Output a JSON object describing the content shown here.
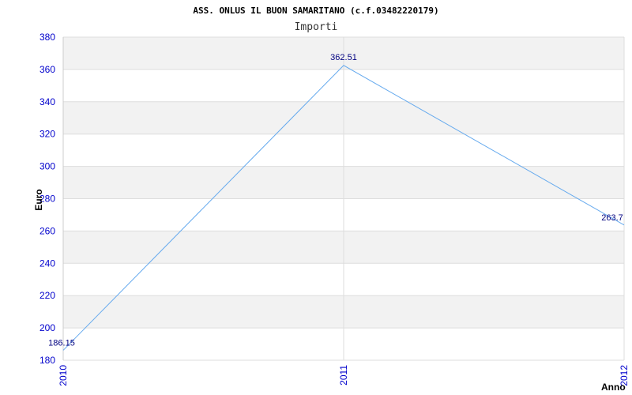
{
  "colors": {
    "band_dark": "#f2f2f2",
    "band_light": "#ffffff",
    "grid": "#dddddd",
    "line": "#66aaee",
    "tick_text": "#0000cc",
    "data_label_text": "#000080"
  },
  "chart_data": {
    "type": "line",
    "title": "ASS. ONLUS IL BUON SAMARITANO (c.f.03482220179)",
    "subtitle": "Importi",
    "xlabel": "Anno",
    "ylabel": "Euro",
    "categories": [
      "2010",
      "2011",
      "2012"
    ],
    "series": [
      {
        "values": [
          186.15,
          362.51,
          263.7
        ]
      }
    ],
    "data_labels": [
      "186.15",
      "362.51",
      "263.7"
    ],
    "ylim": [
      180,
      380
    ],
    "yticks": [
      "180",
      "200",
      "220",
      "240",
      "260",
      "280",
      "300",
      "320",
      "340",
      "360",
      "380"
    ],
    "grid": true,
    "legend": "none"
  }
}
